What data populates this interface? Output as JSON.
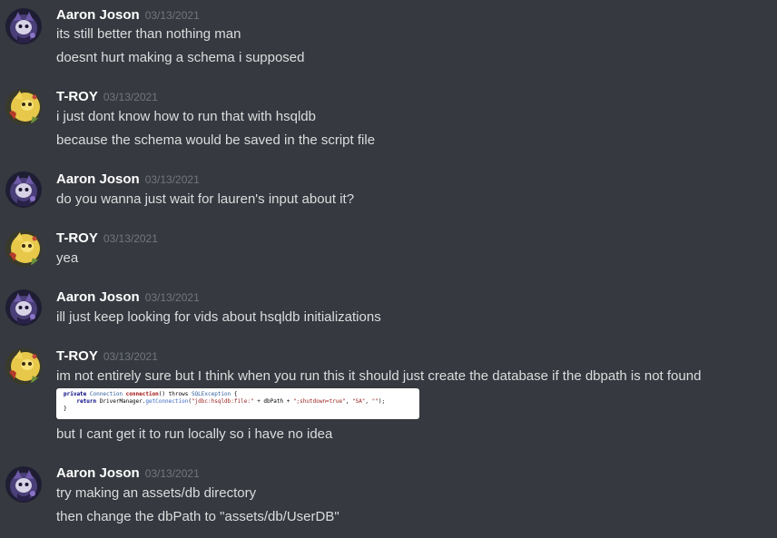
{
  "colors": {
    "background": "#36393f",
    "username": "#ffffff",
    "timestamp": "#72767d",
    "message_text": "#dcddde"
  },
  "users": {
    "aaron": {
      "name": "Aaron Joson",
      "avatar_icon": "purple-character-avatar"
    },
    "troy": {
      "name": "T-ROY",
      "avatar_icon": "yellow-pokemon-avatar"
    }
  },
  "groups": [
    {
      "username": "Aaron Joson",
      "timestamp": "03/13/2021",
      "messages": [
        "its still better than nothing man",
        "doesnt hurt making a schema i supposed"
      ]
    },
    {
      "username": "T-ROY",
      "timestamp": "03/13/2021",
      "messages": [
        "i just dont know how to run that with hsqldb",
        "because the schema would be saved in the script file"
      ]
    },
    {
      "username": "Aaron Joson",
      "timestamp": "03/13/2021",
      "messages": [
        "do you wanna just wait for lauren's input about it?"
      ]
    },
    {
      "username": "T-ROY",
      "timestamp": "03/13/2021",
      "messages": [
        "yea"
      ]
    },
    {
      "username": "Aaron Joson",
      "timestamp": "03/13/2021",
      "messages": [
        "ill just keep looking for vids about hsqldb initializations"
      ]
    },
    {
      "username": "T-ROY",
      "timestamp": "03/13/2021",
      "messages": [
        "im not entirely sure but I think when you run this it should just create the database if the dbpath is not found",
        "but I cant get it to run locally so i have no idea"
      ],
      "code_image": {
        "line1": {
          "kw1": "private",
          "type1": "Connection",
          "fn": "connection",
          "rest": "() throws",
          "type2": "SQLException",
          "brace": "{"
        },
        "line2": {
          "kw": "return",
          "obj": "DriverManager.",
          "method": "getConnection",
          "open": "(",
          "str1": "\"jdbc:hsqldb:file:\"",
          "mid": " + dbPath + ",
          "str2": "\";shutdown=true\"",
          "comma1": ", ",
          "str3": "\"SA\"",
          "comma2": ", ",
          "str4": "\"\"",
          "close": ");"
        },
        "line3": "}"
      }
    },
    {
      "username": "Aaron Joson",
      "timestamp": "03/13/2021",
      "messages": [
        "try making an assets/db directory",
        "then change the dbPath to \"assets/db/UserDB\""
      ]
    }
  ]
}
